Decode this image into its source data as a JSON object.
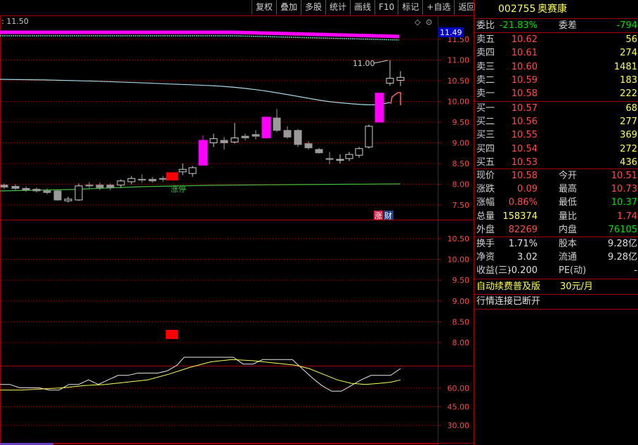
{
  "toolbar": {
    "items": [
      "复权",
      "叠加",
      "多股",
      "统计",
      "画线",
      "F10",
      "标记",
      "+自选",
      "返回"
    ]
  },
  "chart": {
    "ma_label": ": 11.50",
    "current_price_tag": "11.49",
    "high_mark": "11.00",
    "limit_up_label": "涨停",
    "badge_zhang": "涨",
    "badge_cai": "财",
    "main_axis": [
      "11.50",
      "11.00",
      "10.50",
      "10.00",
      "9.50",
      "9.00",
      "8.50",
      "8.00",
      "7.50"
    ],
    "sub_axis": [
      "10.50",
      "10.00",
      "9.50",
      "9.00",
      "8.50",
      "8.00"
    ],
    "osc_axis": [
      "60.00",
      "45.00",
      "30.00"
    ]
  },
  "panel": {
    "code": "002755",
    "name": "奥赛康",
    "weibi_label": "委比",
    "weibi": "-21.83%",
    "weicha_label": "委差",
    "weicha": "-794",
    "asks": [
      {
        "label": "卖五",
        "price": "10.62",
        "vol": "56"
      },
      {
        "label": "卖四",
        "price": "10.61",
        "vol": "274"
      },
      {
        "label": "卖三",
        "price": "10.60",
        "vol": "1481"
      },
      {
        "label": "卖二",
        "price": "10.59",
        "vol": "183"
      },
      {
        "label": "卖一",
        "price": "10.58",
        "vol": "222"
      }
    ],
    "bids": [
      {
        "label": "买一",
        "price": "10.57",
        "vol": "68"
      },
      {
        "label": "买二",
        "price": "10.56",
        "vol": "277"
      },
      {
        "label": "买三",
        "price": "10.55",
        "vol": "369"
      },
      {
        "label": "买四",
        "price": "10.54",
        "vol": "272"
      },
      {
        "label": "买五",
        "price": "10.53",
        "vol": "436"
      }
    ],
    "stats": [
      {
        "l1": "现价",
        "v1": "10.58",
        "c1": "red",
        "l2": "今开",
        "v2": "10.51",
        "c2": "red"
      },
      {
        "l1": "涨跌",
        "v1": "0.09",
        "c1": "red",
        "l2": "最高",
        "v2": "10.73",
        "c2": "red"
      },
      {
        "l1": "涨幅",
        "v1": "0.86%",
        "c1": "red",
        "l2": "最低",
        "v2": "10.37",
        "c2": "grn"
      },
      {
        "l1": "总量",
        "v1": "158374",
        "c1": "yel",
        "l2": "量比",
        "v2": "1.74",
        "c2": "red"
      },
      {
        "l1": "外盘",
        "v1": "82269",
        "c1": "red",
        "l2": "内盘",
        "v2": "76105",
        "c2": "grn"
      }
    ],
    "stats2": [
      {
        "l1": "换手",
        "v1": "1.71%",
        "l2": "股本",
        "v2": "9.28亿"
      },
      {
        "l1": "净资",
        "v1": "3.02",
        "l2": "流通",
        "v2": "9.28亿"
      },
      {
        "l1": "收益(三)",
        "v1": "-0.200",
        "l2": "PE(动)",
        "v2": "-"
      }
    ],
    "promo_left": "自动续费普及版",
    "promo_right": "30元/月",
    "status": "行情连接已断开"
  },
  "colors": {
    "up": "#ff4c4c",
    "down": "#00e000",
    "magenta": "#ff00ff",
    "grid": "#a00000"
  }
}
